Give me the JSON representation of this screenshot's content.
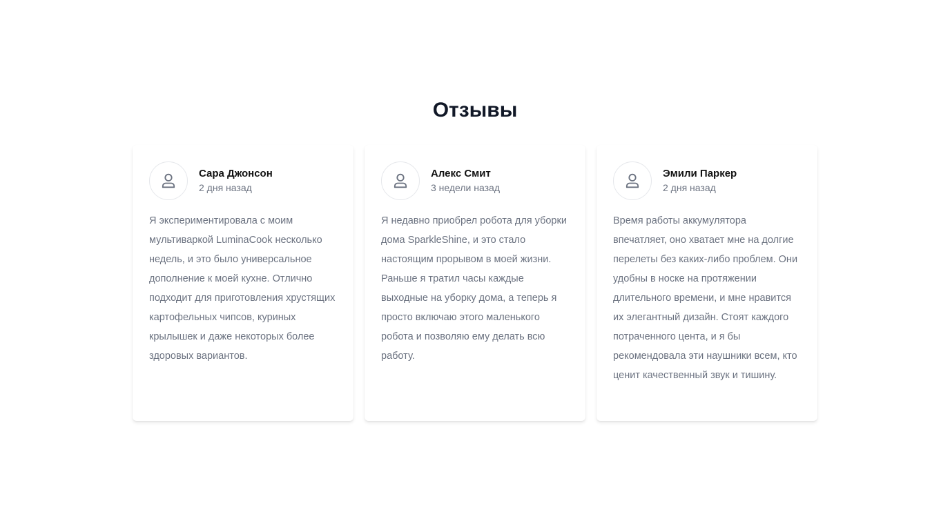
{
  "section": {
    "title": "Отзывы"
  },
  "reviews": [
    {
      "name": "Сара Джонсон",
      "time": "2 дня назад",
      "text": "Я экспериментировала с моим мультиваркой LuminaCook несколько недель, и это было универсальное дополнение к моей кухне. Отлично подходит для приготовления хрустящих картофельных чипсов, куриных крылышек и даже некоторых более здоровых вариантов."
    },
    {
      "name": "Алекс Смит",
      "time": "3 недели назад",
      "text": "Я недавно приобрел робота для уборки дома SparkleShine, и это стало настоящим прорывом в моей жизни. Раньше я тратил часы каждые выходные на уборку дома, а теперь я просто включаю этого маленького робота и позволяю ему делать всю работу."
    },
    {
      "name": "Эмили Паркер",
      "time": "2 дня назад",
      "text": "Время работы аккумулятора впечатляет, оно хватает мне на долгие перелеты без каких-либо проблем. Они удобны в носке на протяжении длительного времени, и мне нравится их элегантный дизайн. Стоят каждого потраченного цента, и я бы рекомендовала эти наушники всем, кто ценит качественный звук и тишину."
    }
  ],
  "icons": {
    "avatar": "user-icon"
  },
  "colors": {
    "title": "#111827",
    "name": "#111111",
    "muted": "#6b7280"
  }
}
